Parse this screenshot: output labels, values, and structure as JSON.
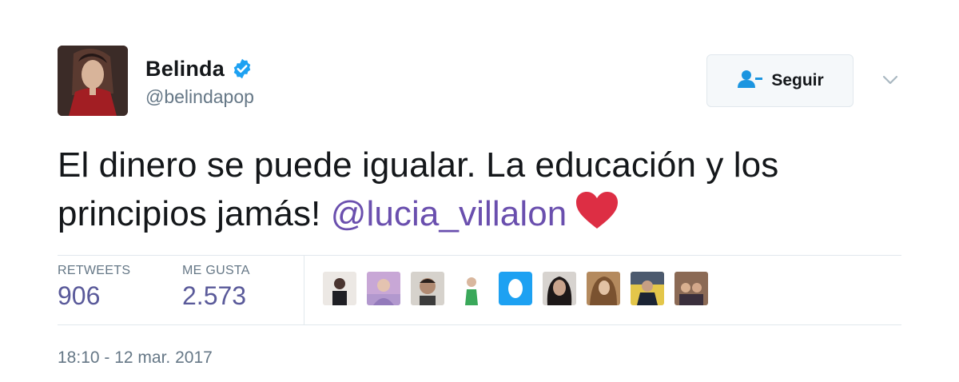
{
  "author": {
    "display_name": "Belinda",
    "handle": "@belindapop",
    "verified_icon": "verified-badge-icon",
    "avatar": "profile-photo"
  },
  "actions": {
    "follow_label": "Seguir",
    "follow_icon": "add-user-icon",
    "menu_icon": "chevron-down-icon"
  },
  "tweet": {
    "text_line1": "El dinero se puede igualar. La educación y los",
    "text_line2_prefix": "principios jamás! ",
    "mention": "@lucia_villalon",
    "emoji": "red-heart-icon"
  },
  "stats": {
    "retweets_label": "RETWEETS",
    "retweets_value": "906",
    "likes_label": "ME GUSTA",
    "likes_value": "2.573"
  },
  "likers": [
    "liker-avatar-1",
    "liker-avatar-2",
    "liker-avatar-3",
    "liker-avatar-4",
    "liker-avatar-5",
    "liker-avatar-6",
    "liker-avatar-7",
    "liker-avatar-8",
    "liker-avatar-9"
  ],
  "timestamp": "18:10 - 12 mar. 2017",
  "colors": {
    "mention": "#6a4fae",
    "verified": "#1da1f2",
    "heart": "#dd2e44",
    "muted": "#657786"
  }
}
